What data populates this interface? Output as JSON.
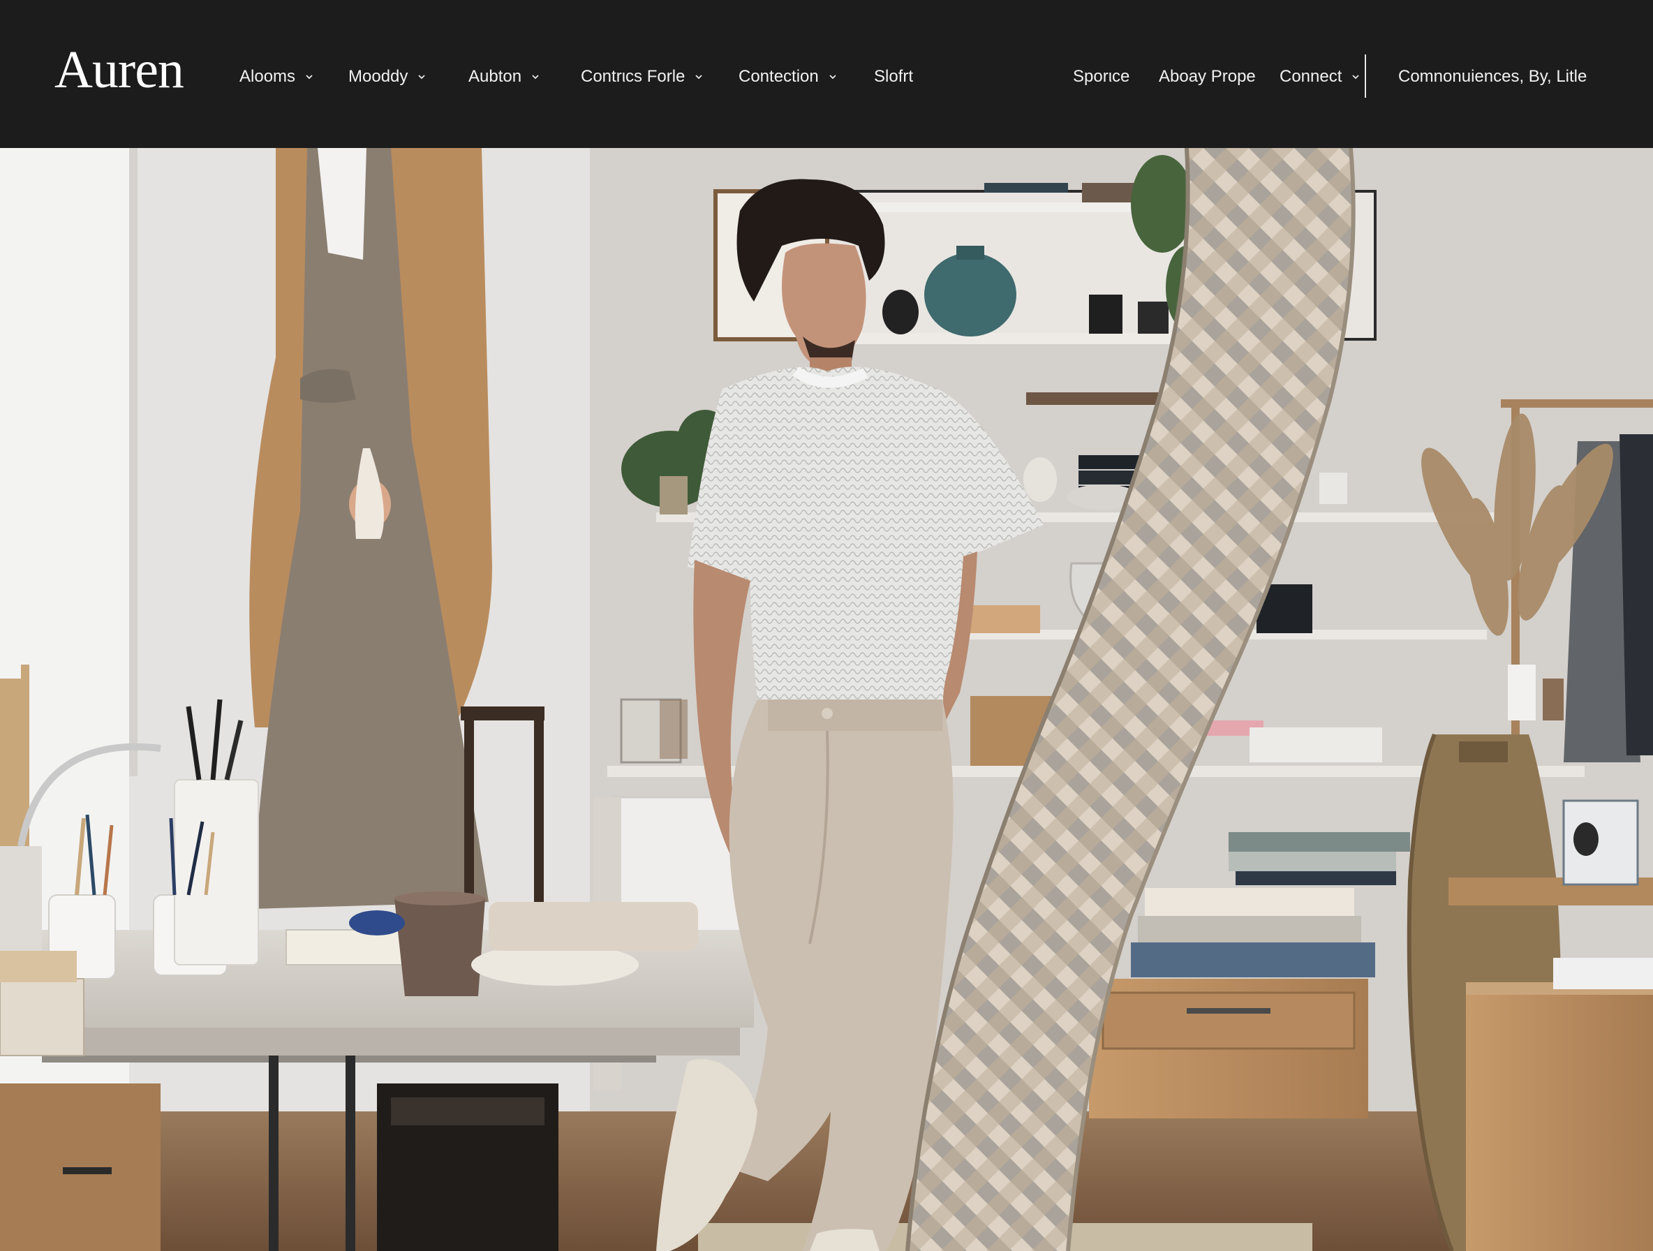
{
  "brand": {
    "logo_text": "Auren"
  },
  "nav": {
    "left_items": [
      {
        "label": "Alooms",
        "has_dropdown": true
      },
      {
        "label": "Mooddy",
        "has_dropdown": true
      },
      {
        "label": "Aubton",
        "has_dropdown": true
      },
      {
        "label": "Contrιcs Forle",
        "has_dropdown": true
      },
      {
        "label": "Contection",
        "has_dropdown": true
      },
      {
        "label": "Slofrt",
        "has_dropdown": false
      }
    ],
    "right_items": [
      {
        "label": "Sporιce",
        "has_dropdown": false
      },
      {
        "label": "Aboay Prope",
        "has_dropdown": false
      },
      {
        "label": "Connect",
        "has_dropdown": true
      }
    ],
    "account_text": "Comnonuiences, By, Litle"
  },
  "colors": {
    "nav_bg": "#1c1c1c",
    "nav_text": "#f1f1f1",
    "wall": "#d9d6d2",
    "floor": "#8a6a4f",
    "shirt": "#e8e8e8",
    "pants": "#cbbfb1",
    "coat": "#b98c5e",
    "sculpture": "#c9b9a4"
  },
  "icons": {
    "dropdown": "chevron-down-icon"
  }
}
